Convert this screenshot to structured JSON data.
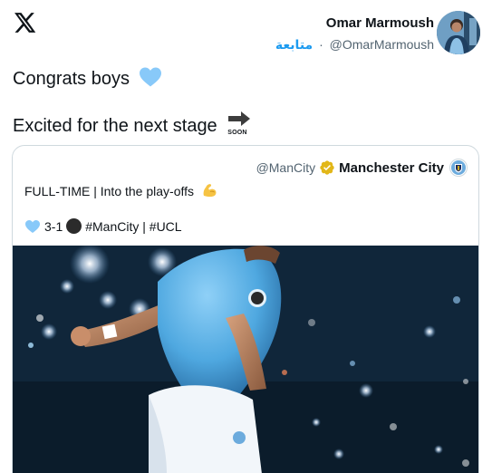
{
  "header": {
    "brand_icon": "x-logo-icon",
    "author_name": "Omar Marmoush",
    "author_handle": "@OmarMarmoush",
    "separator": "·",
    "follow_label": "متابعة"
  },
  "tweet": {
    "line1": "Congrats boys",
    "line1_emoji": "light-blue-heart",
    "line2": "Excited for the next stage",
    "line2_emoji": "soon-arrow",
    "soon_label": "SOON"
  },
  "quote": {
    "handle": "@ManCity",
    "name": "Manchester City",
    "badge": "verified-gold-badge",
    "line1": "FULL-TIME | Into the play-offs",
    "line1_emoji": "flexed-biceps",
    "score": "3-1",
    "tags": "#ManCity | #UCL",
    "photo_description_icon": "player-celebration-photo"
  },
  "colors": {
    "link_blue": "#1d9bf0",
    "city_blue": "#6cabdd",
    "text_primary": "#0f1419",
    "text_secondary": "#536471",
    "border": "#cfd9de"
  }
}
